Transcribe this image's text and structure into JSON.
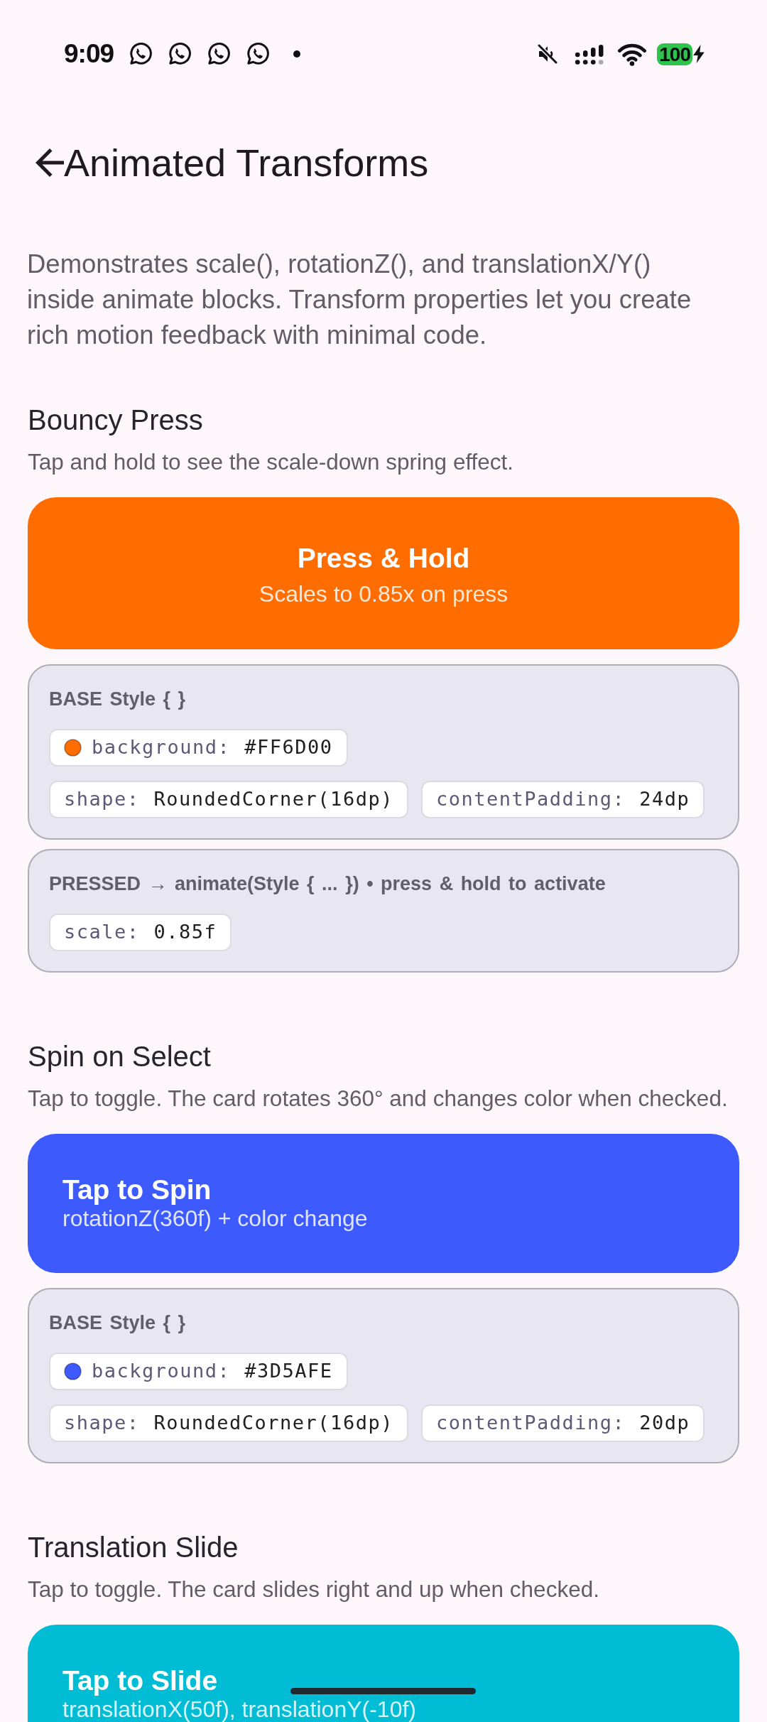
{
  "status_bar": {
    "time": "9:09",
    "notifications": [
      {
        "kind": "chat"
      },
      {
        "kind": "chat"
      },
      {
        "kind": "chat"
      },
      {
        "kind": "chat"
      },
      {
        "kind": "more"
      }
    ],
    "sound_muted": true,
    "battery": "100",
    "charging": true
  },
  "app_bar": {
    "title": "Animated Transforms"
  },
  "intro": "Demonstrates scale(), rotationZ(), and translationX/Y() inside animate blocks. Transform properties let you create rich motion feedback with minimal code.",
  "sections": [
    {
      "title": "Bouncy Press",
      "subtitle": "Tap and hold to see the scale-down spring effect.",
      "card": {
        "kind": "press",
        "title": "Press & Hold",
        "subtitle": "Scales to 0.85x on press",
        "color": "#ff6d00"
      },
      "panels": [
        {
          "heading": "BASE Style { }",
          "rows": [
            [
              {
                "name": "background:",
                "value": "#FF6D00",
                "color": "#ff6d00"
              }
            ],
            [
              {
                "name": "shape:",
                "value": "RoundedCorner(16dp)"
              },
              {
                "name": "contentPadding:",
                "value": "24dp"
              }
            ]
          ]
        },
        {
          "heading": "PRESSED → animate(Style { ... }) • press & hold to activate",
          "rows": [
            [
              {
                "name": "scale:",
                "value": "0.85f"
              }
            ]
          ]
        }
      ]
    },
    {
      "title": "Spin on Select",
      "subtitle": "Tap to toggle. The card rotates 360° and changes color when checked.",
      "card": {
        "kind": "toggle",
        "title": "Tap to Spin",
        "subtitle": "rotationZ(360f) + color change",
        "color": "#3d5afe"
      },
      "panels": [
        {
          "heading": "BASE Style { }",
          "rows": [
            [
              {
                "name": "background:",
                "value": "#3D5AFE",
                "color": "#3d5afe"
              }
            ],
            [
              {
                "name": "shape:",
                "value": "RoundedCorner(16dp)"
              },
              {
                "name": "contentPadding:",
                "value": "20dp"
              }
            ]
          ]
        }
      ]
    },
    {
      "title": "Translation Slide",
      "subtitle": "Tap to toggle. The card slides right and up when checked.",
      "card": {
        "kind": "toggle",
        "title": "Tap to Slide",
        "subtitle": "translationX(50f), translationY(-10f)",
        "color": "#00bcd4"
      }
    }
  ]
}
